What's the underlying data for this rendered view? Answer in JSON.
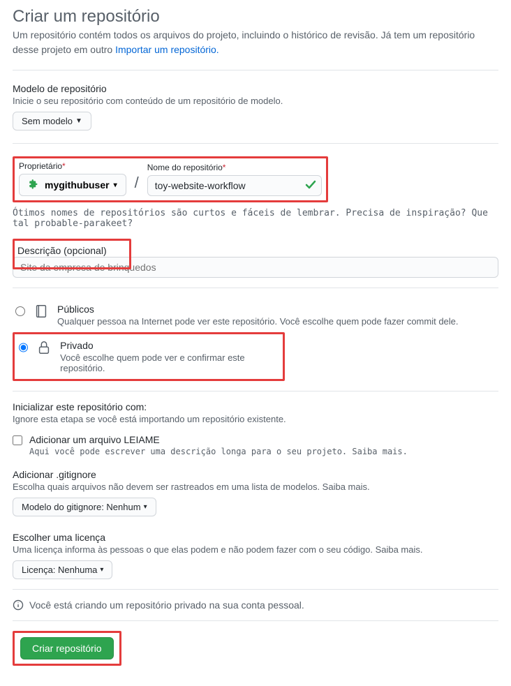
{
  "header": {
    "title": "Criar um repositório",
    "subtitle": "Um repositório contém todos os arquivos do projeto, incluindo o histórico de revisão. Já tem um repositório desse projeto em outro",
    "import_link": "Importar um repositório."
  },
  "template": {
    "label": "Modelo de repositório",
    "help": "Inicie o seu repositório com conteúdo de um repositório de modelo.",
    "button": "Sem modelo"
  },
  "owner": {
    "label": "Proprietário",
    "value": "mygithubuser"
  },
  "repo": {
    "label": "Nome do repositório",
    "value": "toy-website-workflow"
  },
  "suggest_text": "Ótimos nomes de repositórios são curtos e fáceis de lembrar. Precisa de inspiração? Que tal probable-parakeet?",
  "description": {
    "label": "Descrição (opcional)",
    "placeholder": "Site da empresa de brinquedos"
  },
  "visibility": {
    "public": {
      "title": "Públicos",
      "desc": "Qualquer pessoa na Internet pode ver este repositório. Você escolhe quem pode fazer commit dele."
    },
    "private": {
      "title": "Privado",
      "desc": "Você escolhe quem pode ver e confirmar este repositório."
    }
  },
  "init": {
    "title": "Inicializar este repositório com:",
    "help": "Ignore esta etapa se você está importando um repositório existente.",
    "readme_label": "Adicionar um arquivo LEIAME",
    "readme_help": "Aqui você pode escrever uma descrição longa para o seu projeto. Saiba mais."
  },
  "gitignore": {
    "title": "Adicionar .gitignore",
    "help": "Escolha quais arquivos não devem ser rastreados em uma lista de modelos. Saiba mais.",
    "button": "Modelo do gitignore: Nenhum"
  },
  "license": {
    "title": "Escolher uma licença",
    "help": "Uma licença informa às pessoas o que elas podem e não podem fazer com o seu código. Saiba mais.",
    "button": "Licença: Nenhuma"
  },
  "info_text": "Você está criando um repositório privado na sua conta pessoal.",
  "create_button": "Criar repositório"
}
